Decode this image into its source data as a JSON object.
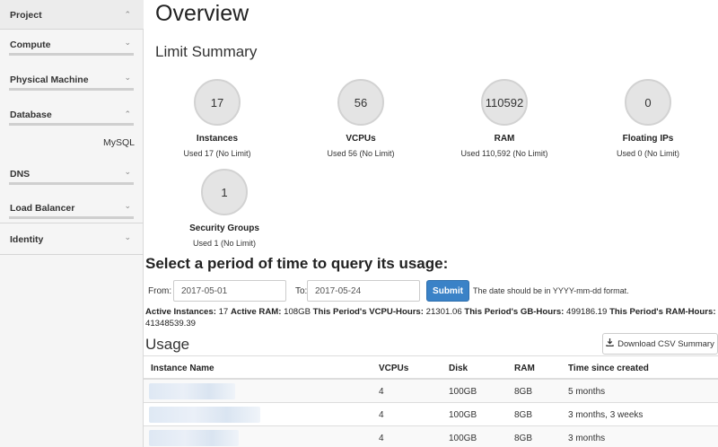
{
  "sidebar": {
    "sections": [
      {
        "label": "Project"
      },
      {
        "label": "Compute"
      },
      {
        "label": "Physical Machine"
      },
      {
        "label": "Database"
      },
      {
        "label": "DNS"
      },
      {
        "label": "Load Balancer"
      },
      {
        "label": "Identity"
      }
    ],
    "database_sub_item": "MySQL"
  },
  "main": {
    "page_title": "Overview",
    "limit_summary_title": "Limit Summary",
    "limits": [
      {
        "value": "17",
        "label": "Instances",
        "used": "Used 17 (No Limit)"
      },
      {
        "value": "56",
        "label": "VCPUs",
        "used": "Used 56 (No Limit)"
      },
      {
        "value": "110592",
        "label": "RAM",
        "used": "Used 110,592 (No Limit)"
      },
      {
        "value": "0",
        "label": "Floating IPs",
        "used": "Used 0 (No Limit)"
      },
      {
        "value": "1",
        "label": "Security Groups",
        "used": "Used 1 (No Limit)"
      }
    ],
    "period_title": "Select a period of time to query its usage:",
    "form": {
      "from_label": "From:",
      "from_value": "2017-05-01",
      "to_label": "To:",
      "to_value": "2017-05-24",
      "submit_label": "Submit",
      "hint": "The date should be in YYYY-mm-dd format."
    },
    "summary": {
      "active_instances_label": "Active Instances:",
      "active_instances": "17",
      "active_ram_label": "Active RAM:",
      "active_ram": "108GB",
      "vcpu_hours_label": "This Period's VCPU-Hours:",
      "vcpu_hours": "21301.06",
      "gb_hours_label": "This Period's GB-Hours:",
      "gb_hours": "499186.19",
      "ram_hours_label": "This Period's RAM-Hours:",
      "ram_hours": "41348539.39"
    },
    "usage_title": "Usage",
    "csv_button": "Download CSV Summary",
    "table": {
      "headers": [
        "Instance Name",
        "VCPUs",
        "Disk",
        "RAM",
        "Time since created"
      ],
      "rows": [
        {
          "vcpus": "4",
          "disk": "100GB",
          "ram": "8GB",
          "time": "5 months"
        },
        {
          "vcpus": "4",
          "disk": "100GB",
          "ram": "8GB",
          "time": "3 months, 3 weeks"
        },
        {
          "vcpus": "4",
          "disk": "100GB",
          "ram": "8GB",
          "time": "3 months"
        }
      ]
    }
  },
  "colors": {
    "accent": "#3a82c7",
    "sidebar_bg": "#f5f5f5",
    "pie_fill": "#e4e4e4"
  },
  "icons": {
    "chevron_up": "chevron-up-icon",
    "chevron_down": "chevron-down-icon",
    "download": "download-icon"
  }
}
